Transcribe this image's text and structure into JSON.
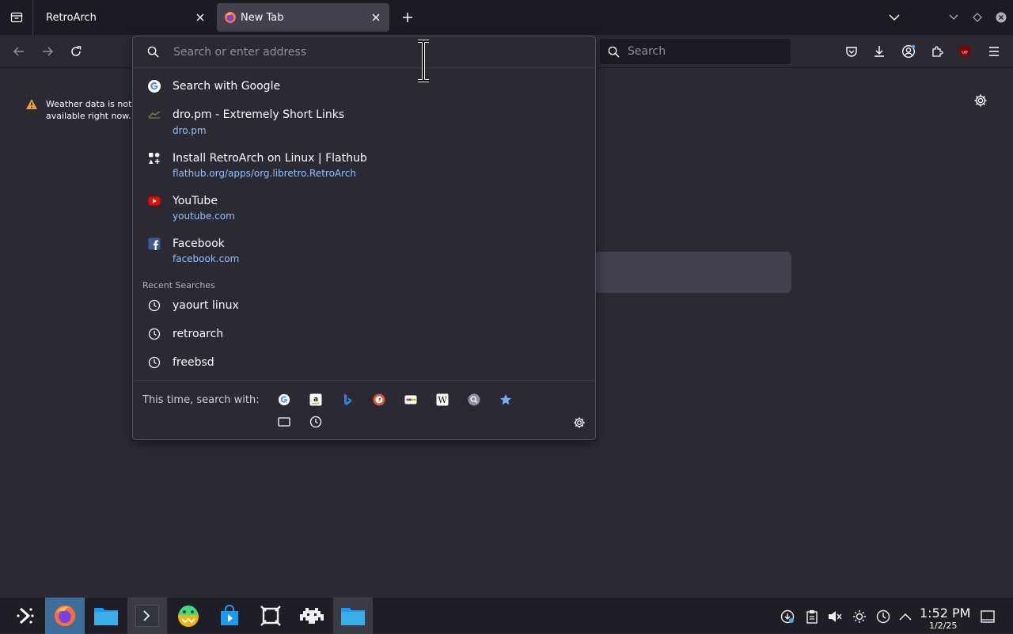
{
  "tabs": [
    {
      "title": "RetroArch",
      "active": false
    },
    {
      "title": "New Tab",
      "active": true
    }
  ],
  "urlbar": {
    "placeholder": "Search or enter address"
  },
  "searchbar": {
    "placeholder": "Search"
  },
  "weather": {
    "line1": "Weather data is not",
    "line2": "available right now."
  },
  "results": [
    {
      "icon": "google-icon",
      "title": "Search with Google",
      "url": ""
    },
    {
      "icon": "dro-pm-favicon",
      "title": "dro.pm - Extremely Short Links",
      "url": "dro.pm"
    },
    {
      "icon": "flathub-favicon",
      "title": "Install RetroArch on Linux | Flathub",
      "url": "flathub.org/apps/org.libretro.RetroArch"
    },
    {
      "icon": "youtube-favicon",
      "title": "YouTube",
      "url": "youtube.com"
    },
    {
      "icon": "facebook-favicon",
      "title": "Facebook",
      "url": "facebook.com"
    }
  ],
  "recent": {
    "header": "Recent Searches",
    "items": [
      "yaourt linux",
      "retroarch",
      "freebsd"
    ]
  },
  "oneoff": {
    "label": "This time, search with:",
    "engines": [
      "google-icon",
      "amazon-icon",
      "bing-icon",
      "duckduckgo-icon",
      "ebay-icon",
      "wikipedia-icon",
      "search-plugin-icon",
      "bookmarks-star-icon",
      "tabs-icon",
      "history-icon"
    ]
  },
  "clock": {
    "time": "1:52 PM",
    "date": "1/2/25"
  },
  "colors": {
    "tabstrip_bg": "#1c1b22",
    "toolbar_bg": "#2b2a33",
    "link": "#8fc1ff",
    "taskbar_active": "#3d6d99",
    "warning": "#e8a33c"
  }
}
